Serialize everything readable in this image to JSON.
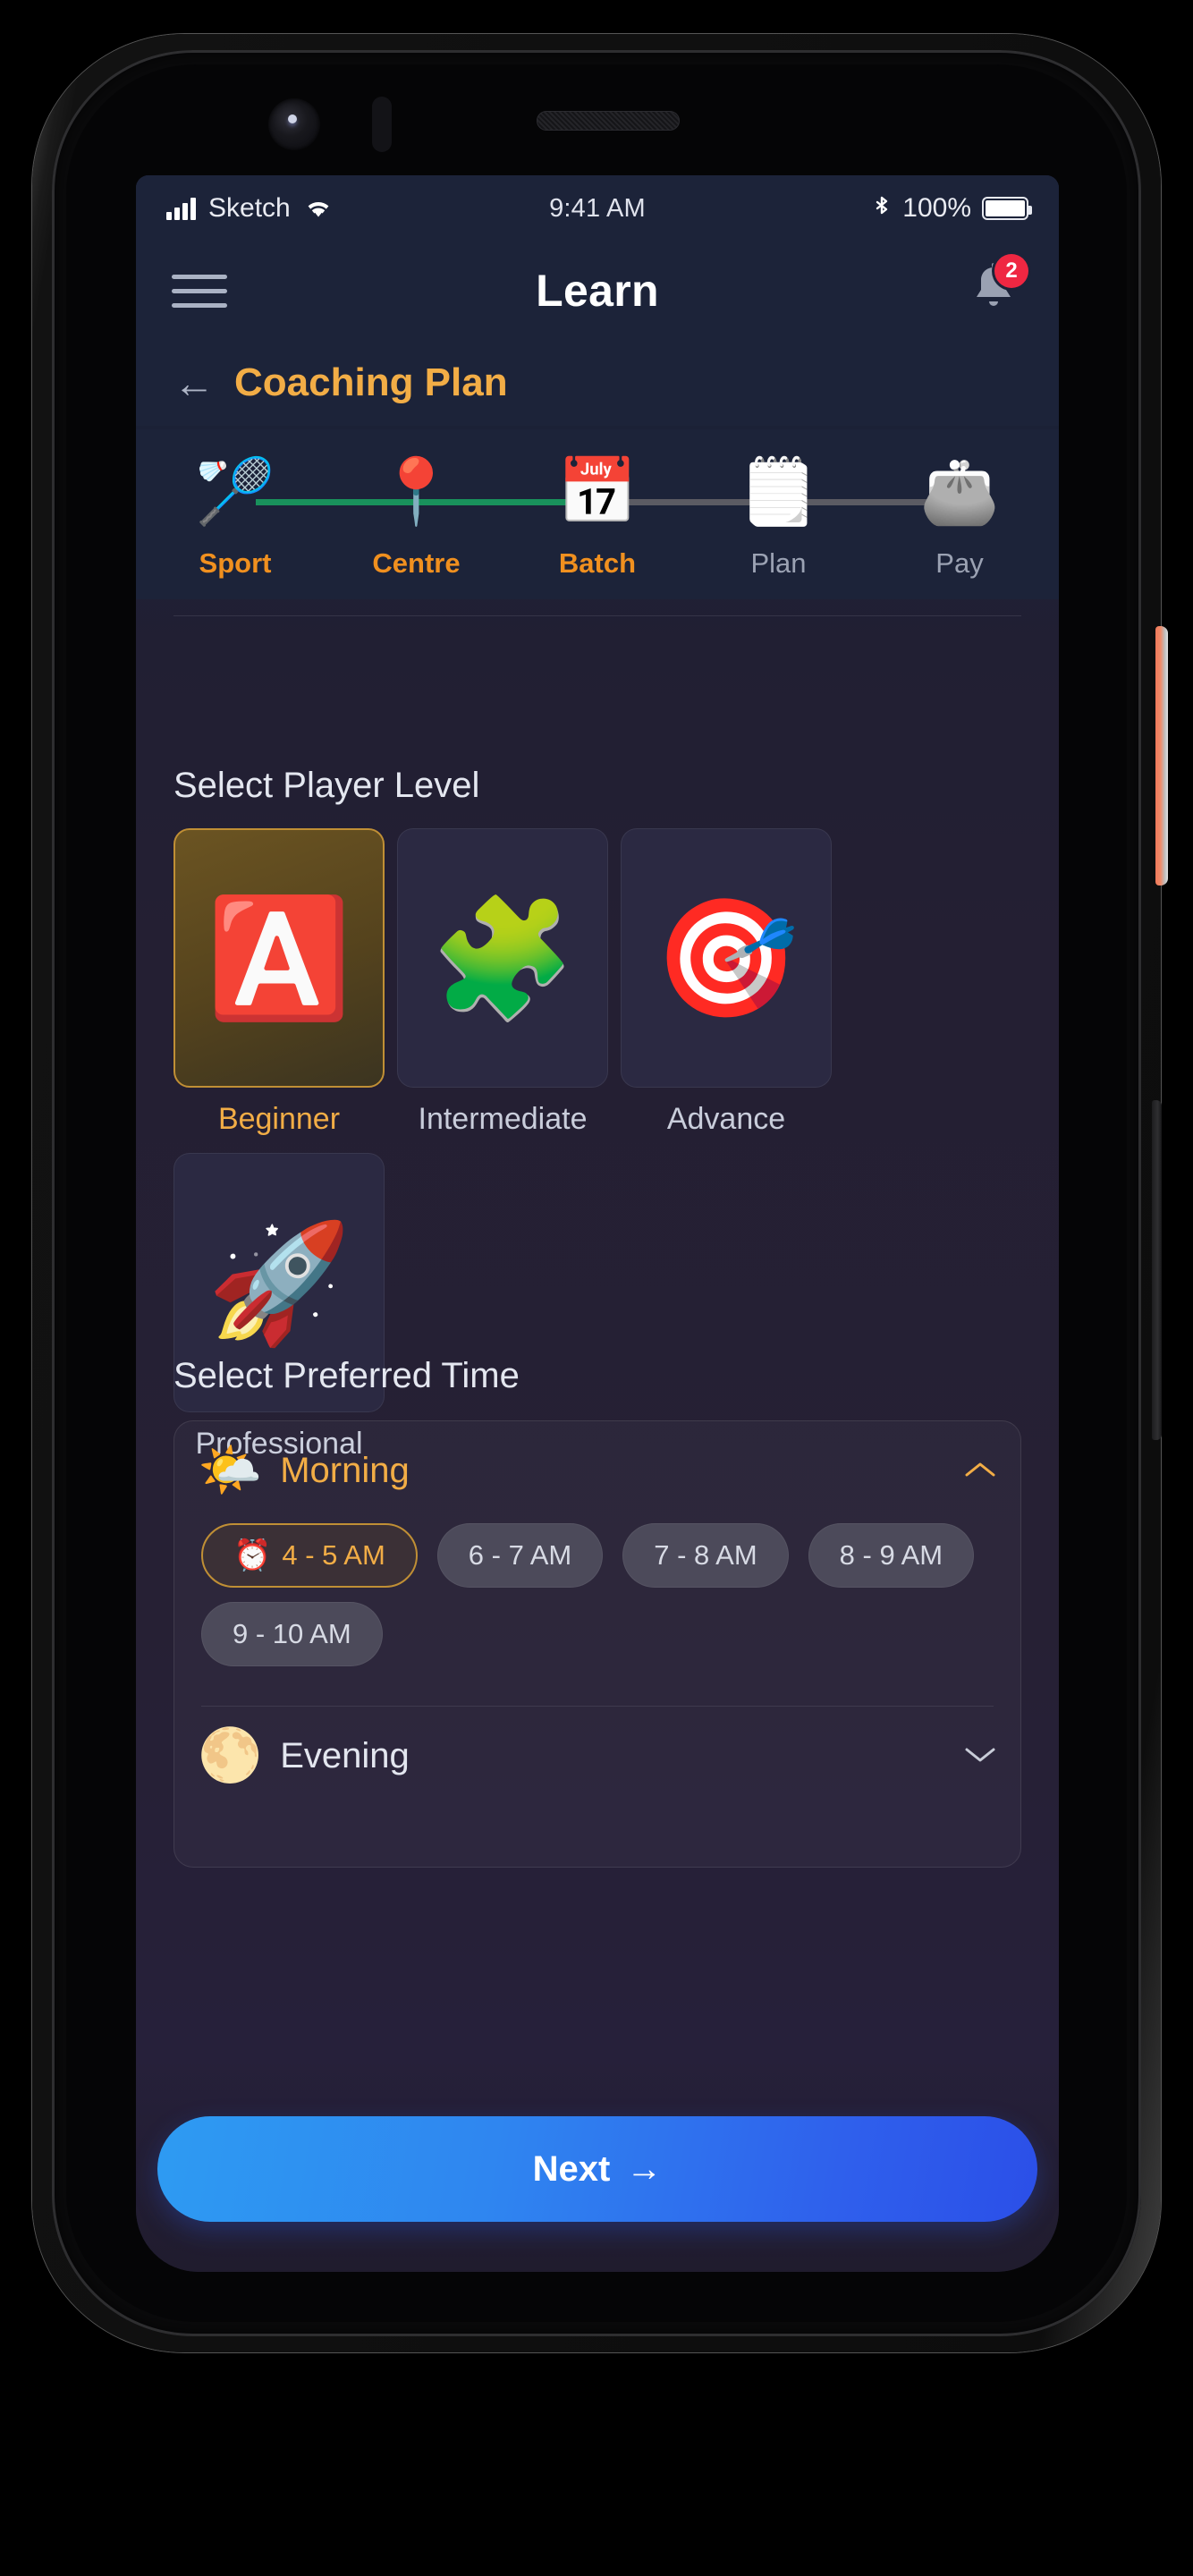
{
  "status_bar": {
    "carrier": "Sketch",
    "signal_icon": "signal-bars-icon",
    "wifi_icon": "wifi-icon",
    "time": "9:41 AM",
    "bluetooth_icon": "bluetooth-icon",
    "battery_percent": "100%",
    "battery_icon": "battery-full-icon"
  },
  "app_bar": {
    "menu_icon": "hamburger-menu-icon",
    "title": "Learn",
    "bell_icon": "notification-bell-icon",
    "notification_count": "2"
  },
  "back_row": {
    "back_icon": "←",
    "title": "Coaching Plan"
  },
  "stepper": {
    "steps": [
      {
        "label": "Sport",
        "emoji": "🏸",
        "state": "done"
      },
      {
        "label": "Centre",
        "emoji": "📍",
        "state": "done"
      },
      {
        "label": "Batch",
        "emoji": "📅",
        "state": "current"
      },
      {
        "label": "Plan",
        "emoji": "🗒️",
        "state": "todo"
      },
      {
        "label": "Pay",
        "emoji": "👛",
        "state": "todo"
      }
    ],
    "connectors": [
      "done",
      "done",
      "todo",
      "todo"
    ]
  },
  "player_level": {
    "title": "Select Player Level",
    "options": [
      {
        "label": "Beginner",
        "emoji": "🅰️",
        "selected": true
      },
      {
        "label": "Intermediate",
        "emoji": "🧩",
        "selected": false
      },
      {
        "label": "Advance",
        "emoji": "🎯",
        "selected": false
      },
      {
        "label": "Professional",
        "emoji": "🚀",
        "selected": false
      }
    ]
  },
  "preferred_time": {
    "title": "Select Preferred Time",
    "groups": [
      {
        "name": "Morning",
        "emoji": "🌤️",
        "expanded": true,
        "chevron": "chevron-up-icon",
        "slots": [
          {
            "label": "4 - 5 AM",
            "emoji": "⏰",
            "selected": true
          },
          {
            "label": "6 - 7 AM",
            "emoji": "",
            "selected": false
          },
          {
            "label": "7 - 8 AM",
            "emoji": "",
            "selected": false
          },
          {
            "label": "8 - 9 AM",
            "emoji": "",
            "selected": false
          },
          {
            "label": "9 - 10 AM",
            "emoji": "",
            "selected": false
          }
        ]
      },
      {
        "name": "Evening",
        "emoji": "🌕",
        "expanded": false,
        "chevron": "chevron-down-icon",
        "slots": []
      }
    ]
  },
  "primary_action": {
    "label": "Next",
    "arrow": "→"
  },
  "colors": {
    "accent_gold": "#f2ad46",
    "screen_bg": "#241f33",
    "header_bg": "#1c2339",
    "badge_red": "#ef2742",
    "step_done": "#19915c",
    "step_todo": "#5b5b63",
    "next_gradient_start": "#2e9bf2",
    "next_gradient_end": "#2b4fe8",
    "side_button": "#f0795a"
  }
}
